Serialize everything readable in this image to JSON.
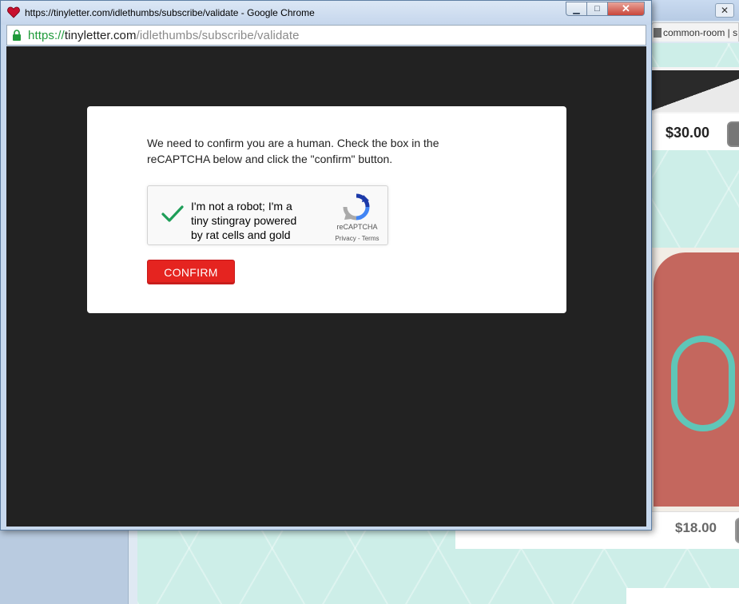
{
  "background_window": {
    "tab_label": "common-room | s",
    "products": [
      {
        "price": "$30.00"
      },
      {
        "price": "$18.00"
      }
    ]
  },
  "popup": {
    "title": "https://tinyletter.com/idlethumbs/subscribe/validate - Google Chrome",
    "favicon": "heart-icon",
    "url": {
      "scheme": "https://",
      "host": "tinyletter.com",
      "path": "/idlethumbs/subscribe/validate"
    }
  },
  "dialog": {
    "message": "We need to confirm you are a human. Check the box in the reCAPTCHA below and click the \"confirm\" button.",
    "recaptcha": {
      "label": "I'm not a robot; I'm a tiny stingray powered by rat cells and gold",
      "checked": true,
      "brand": "reCAPTCHA",
      "links": "Privacy - Terms"
    },
    "confirm_label": "CONFIRM"
  },
  "colors": {
    "confirm_button": "#e52420",
    "checkmark": "#1e9e58",
    "viewport_bg": "#222222",
    "url_scheme": "#1f9a3a"
  }
}
